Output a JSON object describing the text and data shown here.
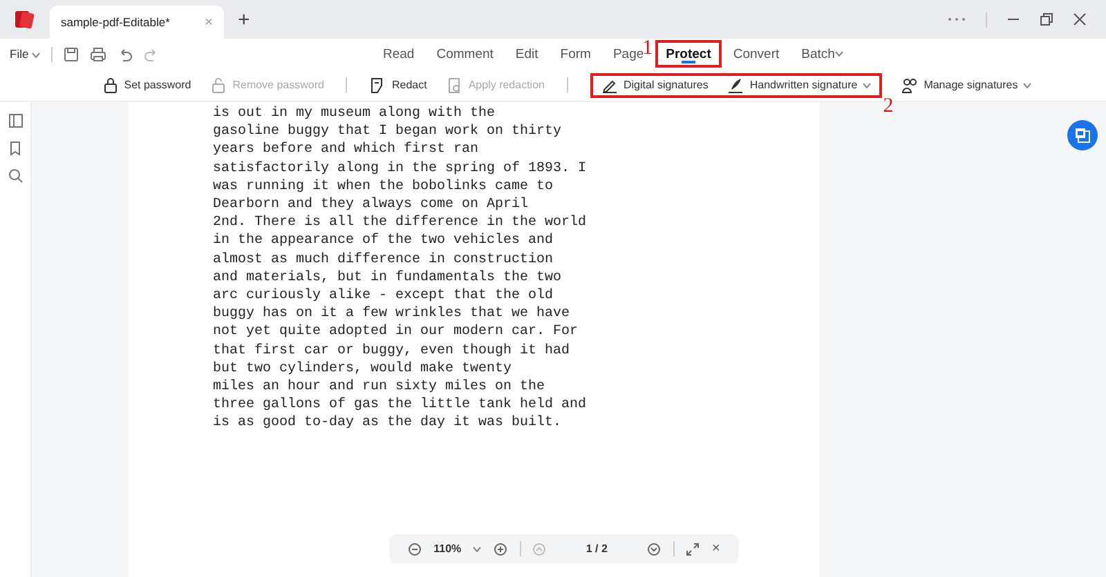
{
  "window": {
    "tab_title": "sample-pdf-Editable*",
    "tab_close": "×",
    "new_tab": "+"
  },
  "toolbar": {
    "file_menu": "File",
    "menu_tabs": [
      {
        "label": "Read",
        "selected": false
      },
      {
        "label": "Comment",
        "selected": false
      },
      {
        "label": "Edit",
        "selected": false
      },
      {
        "label": "Form",
        "selected": false
      },
      {
        "label": "Page",
        "selected": false
      },
      {
        "label": "Protect",
        "selected": true
      },
      {
        "label": "Convert",
        "selected": false
      },
      {
        "label": "Batch",
        "selected": false,
        "dropdown": true
      }
    ]
  },
  "ribbon": [
    {
      "label": "Set password",
      "kind": "lock",
      "disabled": false,
      "dropdown": false
    },
    {
      "label": "Remove password",
      "kind": "unlock",
      "disabled": true,
      "dropdown": false
    },
    {
      "label": "Redact",
      "kind": "redact",
      "disabled": false,
      "dropdown": false,
      "divider_before": true
    },
    {
      "label": "Apply redaction",
      "kind": "apply",
      "disabled": true,
      "dropdown": false
    },
    {
      "label": "Digital signatures",
      "kind": "pen",
      "disabled": false,
      "dropdown": false,
      "divider_before": true,
      "highlighted": true
    },
    {
      "label": "Handwritten signature",
      "kind": "quill",
      "disabled": false,
      "dropdown": true,
      "highlighted": true
    },
    {
      "label": "Manage signatures",
      "kind": "people",
      "disabled": false,
      "dropdown": true
    }
  ],
  "annotations": [
    {
      "number": "1"
    },
    {
      "number": "2"
    }
  ],
  "document_lines": [
    "is out in my museum along with the",
    "gasoline buggy that I began work on thirty",
    "years before and which first ran",
    "satisfactorily along in the spring of 1893. I",
    "was running it when the bobolinks came to",
    "Dearborn and they always come on April",
    "2nd. There is all the difference in the world",
    "in the appearance of the two vehicles and",
    "almost as much difference in construction",
    "and materials, but in fundamentals the two",
    "arc curiously alike - except that the old",
    "buggy has on it a few wrinkles that we have",
    "not yet quite adopted in our modern car. For",
    "that first car or buggy, even though it had",
    "but two cylinders, would make twenty",
    "miles an hour and run sixty miles on the",
    "three gallons of gas the little tank held and",
    "is as good to-day as the day it was built."
  ],
  "zoom_bar": {
    "zoom": "110%",
    "page": "1 / 2",
    "close": "×"
  }
}
